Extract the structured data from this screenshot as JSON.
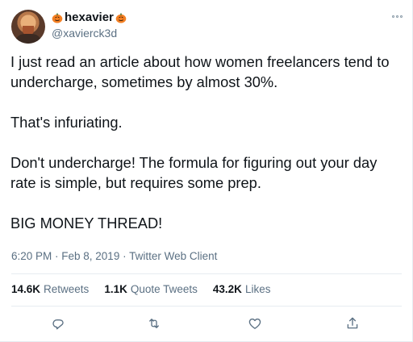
{
  "tweet": {
    "display_name": "hexavier",
    "handle": "@xavierck3d",
    "paragraphs": [
      "I just read an article about how women freelancers tend to undercharge, sometimes by almost 30%.",
      "That's infuriating.",
      "Don't undercharge! The formula for figuring out your day rate is simple, but requires some prep.",
      "BIG MONEY THREAD!"
    ],
    "meta": "6:20 PM · Feb 8, 2019 · Twitter Web Client"
  },
  "stats": {
    "retweets_count": "14.6K",
    "retweets_label": "Retweets",
    "quotes_count": "1.1K",
    "quotes_label": "Quote Tweets",
    "likes_count": "43.2K",
    "likes_label": "Likes"
  },
  "icons": {
    "name_decoration": "pumpkin-icon",
    "more": "more-icon",
    "reply": "reply-icon",
    "retweet": "retweet-icon",
    "like": "heart-icon",
    "share": "share-icon"
  },
  "colors": {
    "text": "#0f1419",
    "secondary": "#5b7083",
    "divider": "#e6ecf0",
    "pumpkin": "#f48024"
  }
}
